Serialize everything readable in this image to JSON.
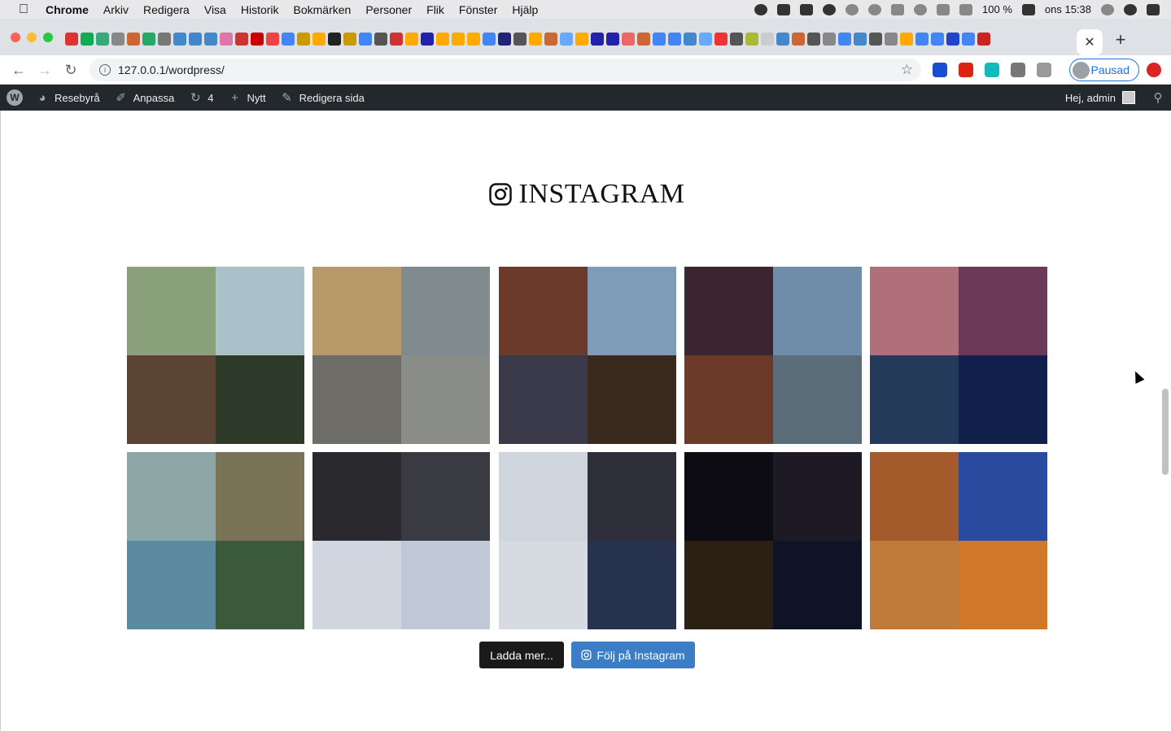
{
  "menubar": {
    "app": "Chrome",
    "items": [
      "Arkiv",
      "Redigera",
      "Visa",
      "Historik",
      "Bokmärken",
      "Personer",
      "Flik",
      "Fönster",
      "Hjälp"
    ],
    "battery": "100 %",
    "clock": "ons 15:38"
  },
  "browser": {
    "url": "127.0.0.1/wordpress/",
    "profile_label": "Pausad",
    "pinned_tab_colors": [
      "#d33",
      "#1a5",
      "#3a7",
      "#888",
      "#c63",
      "#2a6",
      "#777",
      "#48c",
      "#48c",
      "#48c",
      "#d7a",
      "#c33",
      "#c00",
      "#e44",
      "#4285f4",
      "#c90",
      "#fa0",
      "#222",
      "#c90",
      "#4285f4",
      "#555",
      "#c33",
      "#fa0",
      "#22a",
      "#fa0",
      "#fa0",
      "#fa0",
      "#4285f4",
      "#227",
      "#555",
      "#fa0",
      "#c63",
      "#6af",
      "#fa0",
      "#22a",
      "#22a",
      "#e66",
      "#c63",
      "#4285f4",
      "#4285f4",
      "#48c",
      "#6af",
      "#e33",
      "#555",
      "#ab3",
      "#ccc",
      "#48c",
      "#c63",
      "#555",
      "#888",
      "#4285f4",
      "#48c",
      "#555",
      "#888",
      "#fa0",
      "#4285f4",
      "#4285f4",
      "#24c",
      "#4285f4",
      "#c22"
    ]
  },
  "wp_admin_bar": {
    "site_name": "Resebyrå",
    "customize": "Anpassa",
    "updates_count": "4",
    "new": "Nytt",
    "edit_page": "Redigera sida",
    "greeting": "Hej, admin"
  },
  "instagram": {
    "title": "INSTAGRAM",
    "load_more": "Ladda mer...",
    "follow": "Följ på Instagram",
    "photos": [
      {
        "desc": "balcony-view",
        "quads": [
          "#8aa07a",
          "#a9c1c9",
          "#5c4435",
          "#2d3a2a"
        ]
      },
      {
        "desc": "man-on-stairs",
        "quads": [
          "#b89a6a",
          "#7f8b8e",
          "#6e6c66",
          "#8a8d88"
        ]
      },
      {
        "desc": "food-and-square",
        "quads": [
          "#6b3a2a",
          "#7d9cb8",
          "#3b3a4a",
          "#3a2a1e"
        ]
      },
      {
        "desc": "amsterdam-collage",
        "quads": [
          "#3b2530",
          "#6f8ca8",
          "#6b3a28",
          "#5b6d78"
        ]
      },
      {
        "desc": "sunset-collage",
        "quads": [
          "#b0707a",
          "#6a3a58",
          "#243a5a",
          "#10204a"
        ]
      },
      {
        "desc": "interrail-pass",
        "quads": [
          "#8da7a6",
          "#7a7358",
          "#5c8aa0",
          "#3b5a3a"
        ]
      },
      {
        "desc": "ice-hockey-arena",
        "quads": [
          "#2a2a2e",
          "#3a3a42",
          "#d0d6e0",
          "#bfc8d6"
        ]
      },
      {
        "desc": "skating-child",
        "quads": [
          "#cfd5dc",
          "#2e2f3a",
          "#d6dbe2",
          "#27324f"
        ]
      },
      {
        "desc": "night-amusement-park",
        "quads": [
          "#0c0c12",
          "#1d1a26",
          "#2c2014",
          "#0e1426"
        ]
      },
      {
        "desc": "pastries-on-plate",
        "quads": [
          "#a45a2a",
          "#2a4aa0",
          "#c07a3a",
          "#d0782a"
        ]
      }
    ]
  }
}
